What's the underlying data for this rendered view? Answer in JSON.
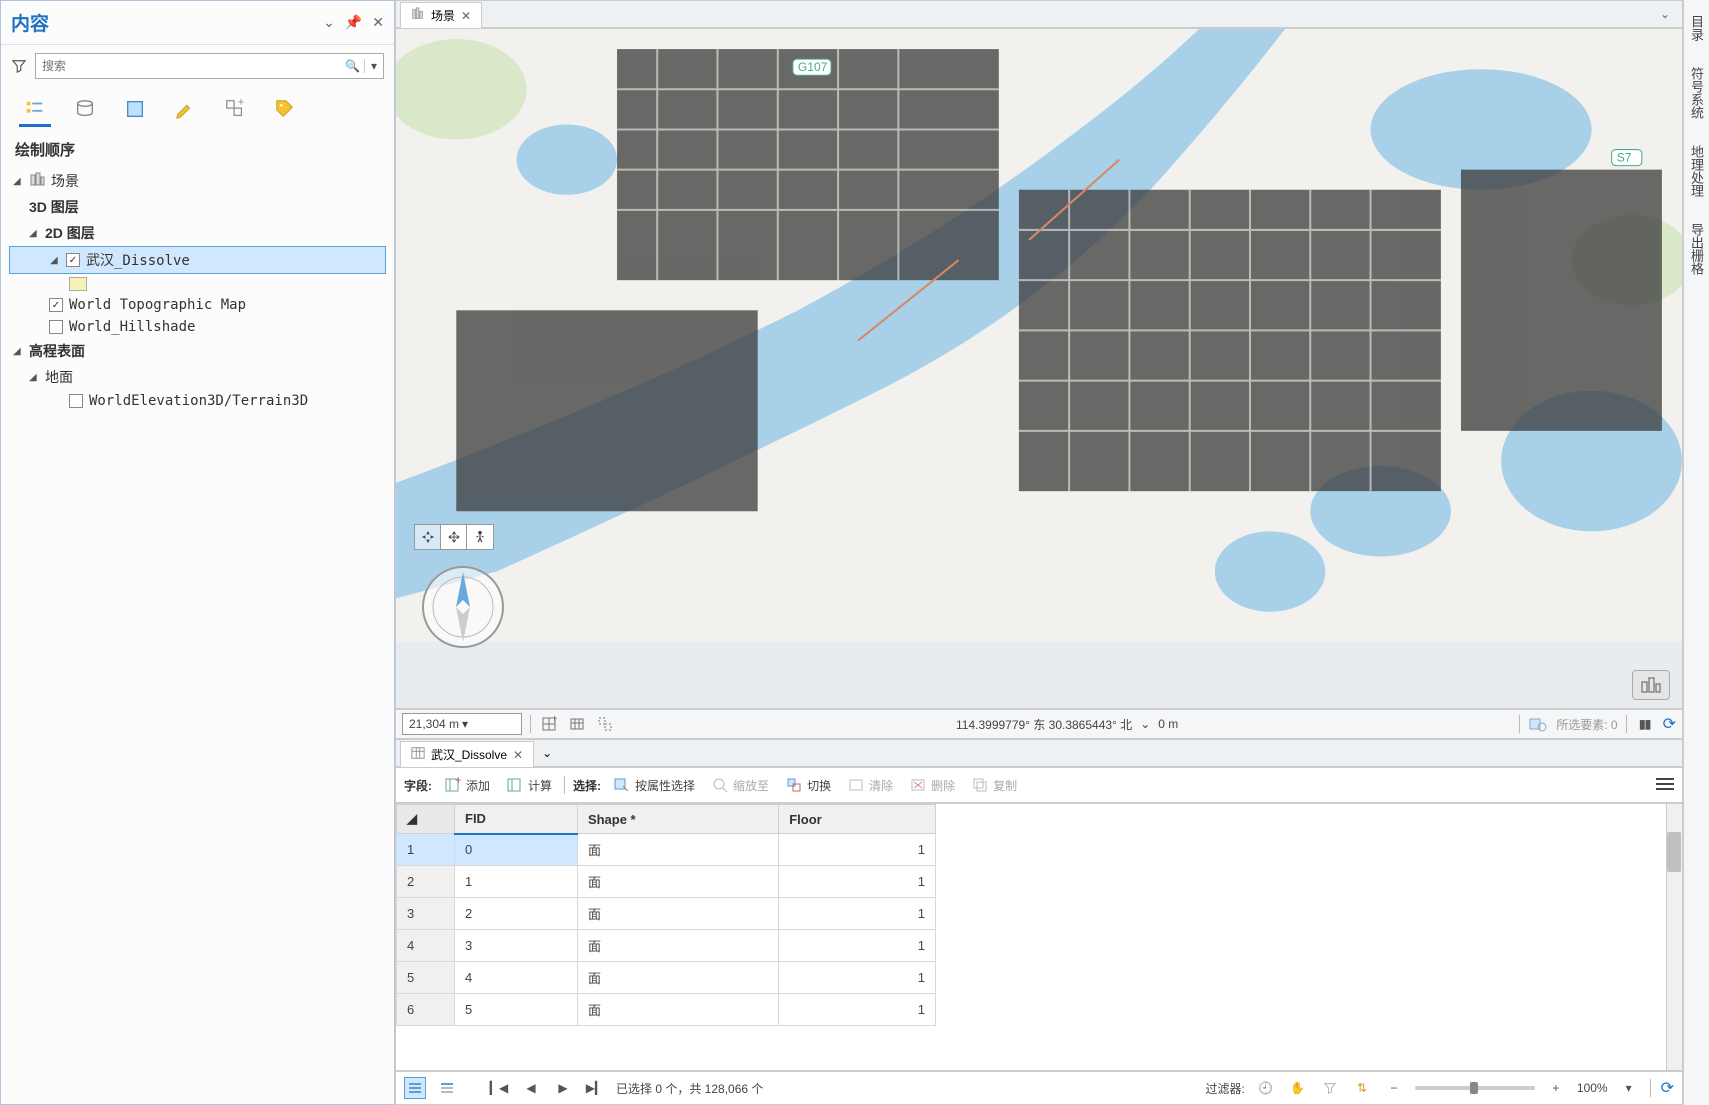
{
  "contents": {
    "title": "内容",
    "search_placeholder": "搜索",
    "section": "绘制顺序",
    "scene_label": "场景",
    "group_3d": "3D 图层",
    "group_2d": "2D 图层",
    "layer_dissolve": "武汉_Dissolve",
    "layer_topo": "World Topographic Map",
    "layer_hillshade": "World_Hillshade",
    "elevation_group": "高程表面",
    "ground_group": "地面",
    "terrain3d": "WorldElevation3D/Terrain3D"
  },
  "scene_tab": {
    "label": "场景"
  },
  "map_status": {
    "scale": "21,304 m",
    "coords": "114.3999779° 东 30.3865443° 北",
    "elev": "0 m",
    "selected": "所选要素: 0"
  },
  "table_tab": {
    "label": "武汉_Dissolve"
  },
  "table_toolbar": {
    "fields_label": "字段:",
    "add": "添加",
    "calc": "计算",
    "select_label": "选择:",
    "by_attr": "按属性选择",
    "zoom_to": "缩放至",
    "switch": "切换",
    "clear": "清除",
    "delete": "删除",
    "copy": "复制"
  },
  "table": {
    "headers": {
      "fid": "FID",
      "shape": "Shape *",
      "floor": "Floor"
    },
    "rows": [
      {
        "n": "1",
        "fid": "0",
        "shape": "面",
        "floor": "1"
      },
      {
        "n": "2",
        "fid": "1",
        "shape": "面",
        "floor": "1"
      },
      {
        "n": "3",
        "fid": "2",
        "shape": "面",
        "floor": "1"
      },
      {
        "n": "4",
        "fid": "3",
        "shape": "面",
        "floor": "1"
      },
      {
        "n": "5",
        "fid": "4",
        "shape": "面",
        "floor": "1"
      },
      {
        "n": "6",
        "fid": "5",
        "shape": "面",
        "floor": "1"
      }
    ]
  },
  "table_footer": {
    "status": "已选择 0 个，共 128,066 个",
    "filter_label": "过滤器:",
    "zoom_pct": "100%"
  },
  "right_tabs": {
    "catalog": "目录",
    "symbology": "符号系统",
    "geoprocessing": "地理处理",
    "export": "导出栅格"
  }
}
